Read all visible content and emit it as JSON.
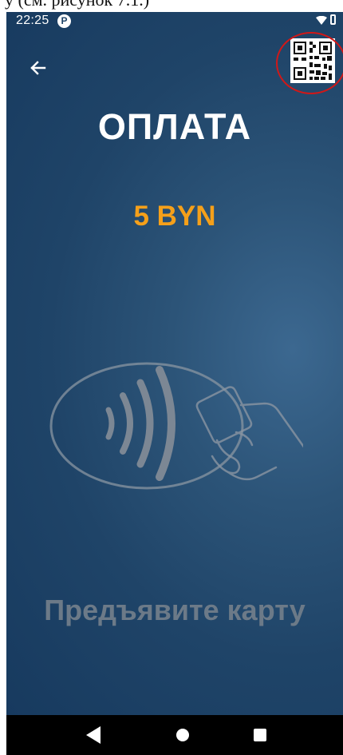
{
  "caption": {
    "text": "у (см. рисунок 7.1.)"
  },
  "status_bar": {
    "time": "22:25",
    "notification_icon": "parking-app-icon",
    "notification_glyph": "P",
    "wifi_icon": "wifi-icon",
    "battery_icon": "battery-icon"
  },
  "header": {
    "back_icon": "arrow-left-icon",
    "qr_icon": "qr-code-icon",
    "highlight_color": "#d01818"
  },
  "payment": {
    "title": "ОПЛАТА",
    "amount": "5 BYN",
    "amount_color": "#f5a01a",
    "illustration_icon": "contactless-card-icon",
    "prompt": "Предъявите карту"
  },
  "nav_bar": {
    "back_icon": "triangle-back-icon",
    "home_icon": "circle-home-icon",
    "recents_icon": "square-recents-icon"
  },
  "colors": {
    "background": "#1f4468",
    "title": "#ffffff",
    "prompt": "#6c7a88"
  }
}
